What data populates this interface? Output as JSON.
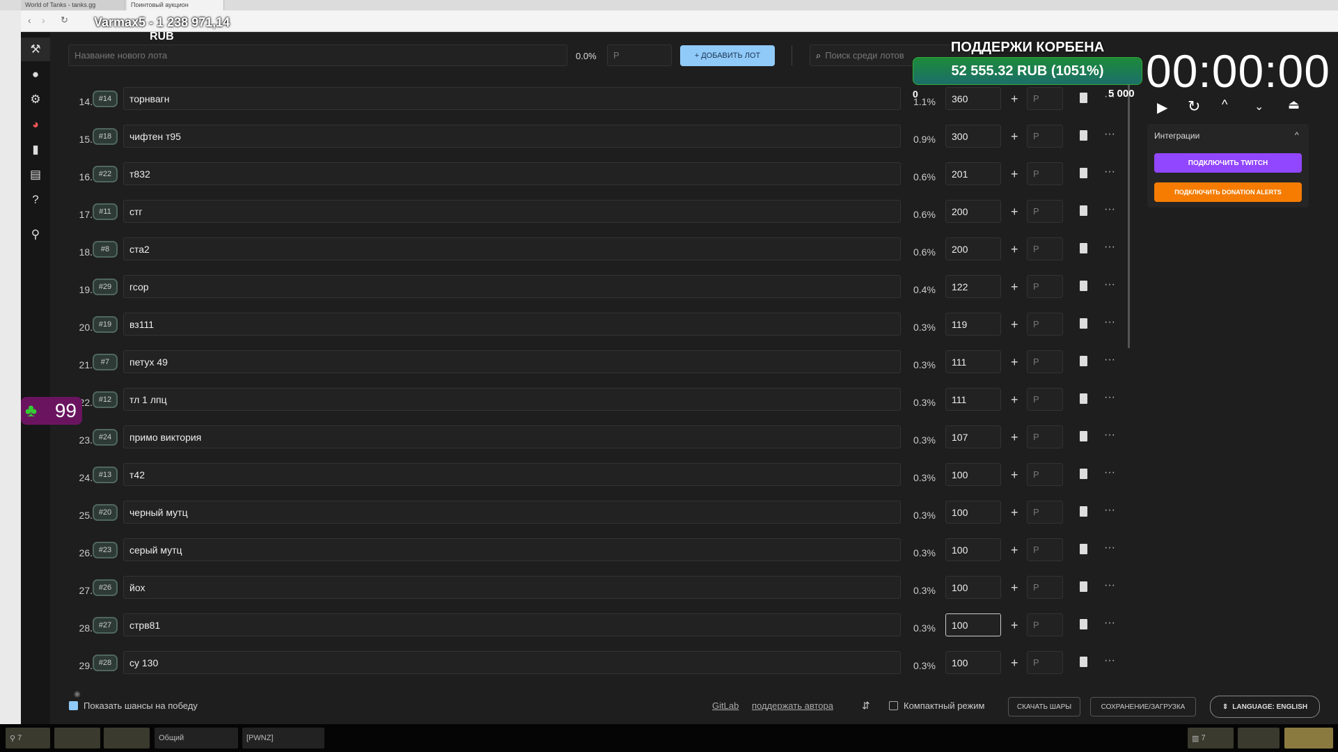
{
  "browser": {
    "tabs": [
      {
        "label": "World of Tanks - tanks.gg"
      },
      {
        "label": "Поинтовый аукцион"
      }
    ],
    "overlay_title": "Varmax5 - 1 238 971,14"
  },
  "currency": "RUB",
  "top": {
    "lot_name_placeholder": "Название нового лота",
    "percent": "0.0%",
    "amount_placeholder": "Р",
    "add_label": "+ ДОБАВИТЬ ЛОТ",
    "search_placeholder": "Поиск среди лотов"
  },
  "donation": {
    "title": "ПОДДЕРЖИ КОРБЕНА",
    "amount_text": "52 555.32 RUB (1051%)",
    "min": "0",
    "max": "5 000",
    "progress_percent": 1051,
    "color": "#1f7a5a"
  },
  "timer": "00:00:00",
  "integrations": {
    "title": "Интеграции",
    "twitch": "ПОДКЛЮЧИТЬ TWITCH",
    "donation_alerts": "ПОДКЛЮЧИТЬ DONATION ALERTS",
    "twitch_color": "#9146ff",
    "da_color": "#f57c00"
  },
  "lots": [
    {
      "n": "14.",
      "tag": "#14",
      "name": "торнвагн",
      "pct": "1.1%",
      "amount": "360"
    },
    {
      "n": "15.",
      "tag": "#18",
      "name": "чифтен т95",
      "pct": "0.9%",
      "amount": "300"
    },
    {
      "n": "16.",
      "tag": "#22",
      "name": "т832",
      "pct": "0.6%",
      "amount": "201"
    },
    {
      "n": "17.",
      "tag": "#11",
      "name": "стг",
      "pct": "0.6%",
      "amount": "200"
    },
    {
      "n": "18.",
      "tag": "#8",
      "name": "ста2",
      "pct": "0.6%",
      "amount": "200"
    },
    {
      "n": "19.",
      "tag": "#29",
      "name": "гсор",
      "pct": "0.4%",
      "amount": "122"
    },
    {
      "n": "20.",
      "tag": "#19",
      "name": "вз111",
      "pct": "0.3%",
      "amount": "119"
    },
    {
      "n": "21.",
      "tag": "#7",
      "name": "петух 49",
      "pct": "0.3%",
      "amount": "111"
    },
    {
      "n": "22.",
      "tag": "#12",
      "name": "тл 1 лпц",
      "pct": "0.3%",
      "amount": "111"
    },
    {
      "n": "23.",
      "tag": "#24",
      "name": "примо виктория",
      "pct": "0.3%",
      "amount": "107"
    },
    {
      "n": "24.",
      "tag": "#13",
      "name": "т42",
      "pct": "0.3%",
      "amount": "100"
    },
    {
      "n": "25.",
      "tag": "#20",
      "name": "черный мутц",
      "pct": "0.3%",
      "amount": "100"
    },
    {
      "n": "26.",
      "tag": "#23",
      "name": "серый мутц",
      "pct": "0.3%",
      "amount": "100"
    },
    {
      "n": "27.",
      "tag": "#26",
      "name": "йох",
      "pct": "0.3%",
      "amount": "100"
    },
    {
      "n": "28.",
      "tag": "#27",
      "name": "стрв81",
      "pct": "0.3%",
      "amount": "100"
    },
    {
      "n": "29.",
      "tag": "#28",
      "name": "су 130",
      "pct": "0.3%",
      "amount": "100"
    }
  ],
  "lot_bid_placeholder": "Р",
  "footer": {
    "show_chances": "Показать шансы на победу",
    "gitlab": "GitLab",
    "support": "поддержать автора",
    "compact": "Компактный режим",
    "download": "СКАЧАТЬ ШАРЫ",
    "save_load": "СОХРАНЕНИЕ/ЗАГРУЗКА",
    "language": "LANGUAGE: ENGLISH"
  },
  "overlay_badge": "99",
  "taskbar": {
    "item1": "7",
    "chat_general": "Общий",
    "chat_clan": "[PWNZ]",
    "item_right": "7"
  }
}
